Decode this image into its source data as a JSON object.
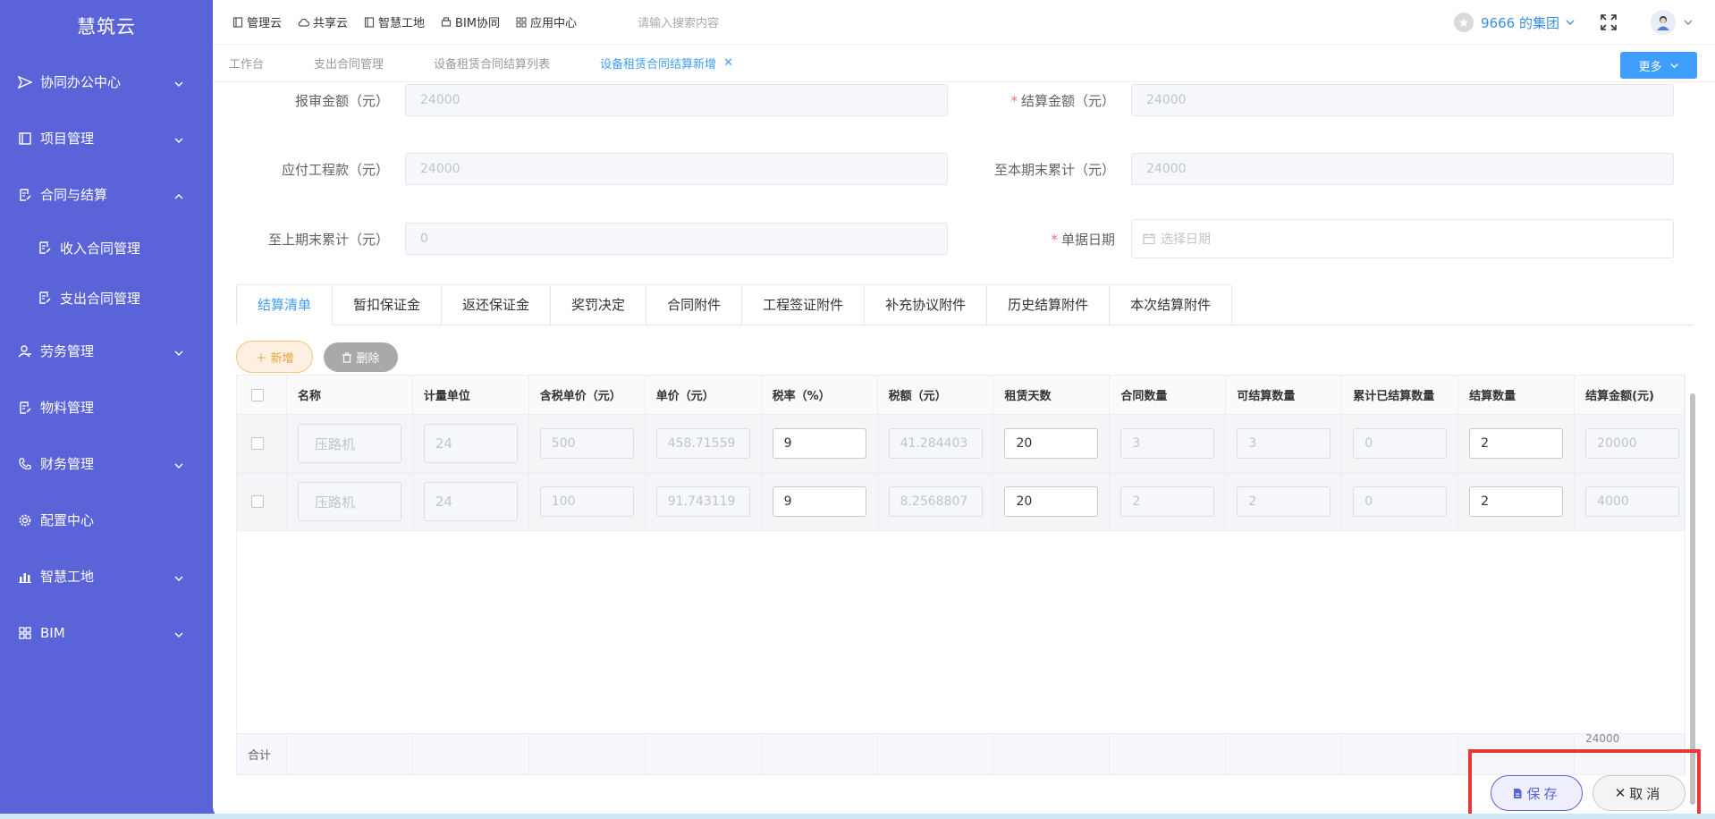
{
  "app": {
    "brand": "慧筑云"
  },
  "sidebar": {
    "items": [
      {
        "label": "协同办公中心",
        "icon": "send-icon",
        "chevron": "down"
      },
      {
        "label": "项目管理",
        "icon": "book-icon",
        "chevron": "down"
      },
      {
        "label": "合同与结算",
        "icon": "edit-doc-icon",
        "chevron": "up"
      },
      {
        "label": "收入合同管理",
        "icon": "edit-doc-icon",
        "chevron": ""
      },
      {
        "label": "支出合同管理",
        "icon": "edit-doc-icon",
        "chevron": ""
      },
      {
        "label": "劳务管理",
        "icon": "user-group-icon",
        "chevron": "down"
      },
      {
        "label": "物料管理",
        "icon": "edit-doc-icon",
        "chevron": ""
      },
      {
        "label": "财务管理",
        "icon": "phone-icon",
        "chevron": "down"
      },
      {
        "label": "配置中心",
        "icon": "gear-icon",
        "chevron": ""
      },
      {
        "label": "智慧工地",
        "icon": "bar-chart-icon",
        "chevron": "down"
      },
      {
        "label": "BIM",
        "icon": "grid-icon",
        "chevron": "down"
      }
    ]
  },
  "topbar": {
    "nav": [
      "管理云",
      "共享云",
      "智慧工地",
      "BIM协同",
      "应用中心"
    ],
    "search_placeholder": "请输入搜索内容",
    "org": "9666 的集团"
  },
  "tabs": {
    "items": [
      "工作台",
      "支出合同管理",
      "设备租赁合同结算列表",
      "设备租赁合同结算新增"
    ],
    "more": "更多"
  },
  "form": {
    "report_amount_label": "报审金额（元）",
    "report_amount": "24000",
    "settle_amount_label": "结算金额（元）",
    "settle_amount": "24000",
    "payable_label": "应付工程款（元）",
    "payable": "24000",
    "cum_current_label": "至本期末累计（元）",
    "cum_current": "24000",
    "cum_prev_label": "至上期末累计（元）",
    "cum_prev": "0",
    "doc_date_label": "单据日期",
    "doc_date_placeholder": "选择日期"
  },
  "detail_tabs": [
    "结算清单",
    "暂扣保证金",
    "返还保证金",
    "奖罚决定",
    "合同附件",
    "工程签证附件",
    "补充协议附件",
    "历史结算附件",
    "本次结算附件"
  ],
  "actions": {
    "add": "新增",
    "delete": "删除"
  },
  "table": {
    "headers": [
      "名称",
      "计量单位",
      "含税单价（元）",
      "单价（元）",
      "税率（%）",
      "税额（元）",
      "租赁天数",
      "合同数量",
      "可结算数量",
      "累计已结算数量",
      "结算数量",
      "结算金额(元)"
    ],
    "rows": [
      [
        "压路机",
        "24",
        "500",
        "458.71559",
        "9",
        "41.284403",
        "20",
        "3",
        "3",
        "0",
        "2",
        "20000"
      ],
      [
        "压路机",
        "24",
        "100",
        "91.743119",
        "9",
        "8.2568807",
        "20",
        "2",
        "2",
        "0",
        "2",
        "4000"
      ]
    ],
    "sum_label": "合计",
    "sum_amount": "24000"
  },
  "footer": {
    "save": "保存",
    "cancel": "取消"
  }
}
